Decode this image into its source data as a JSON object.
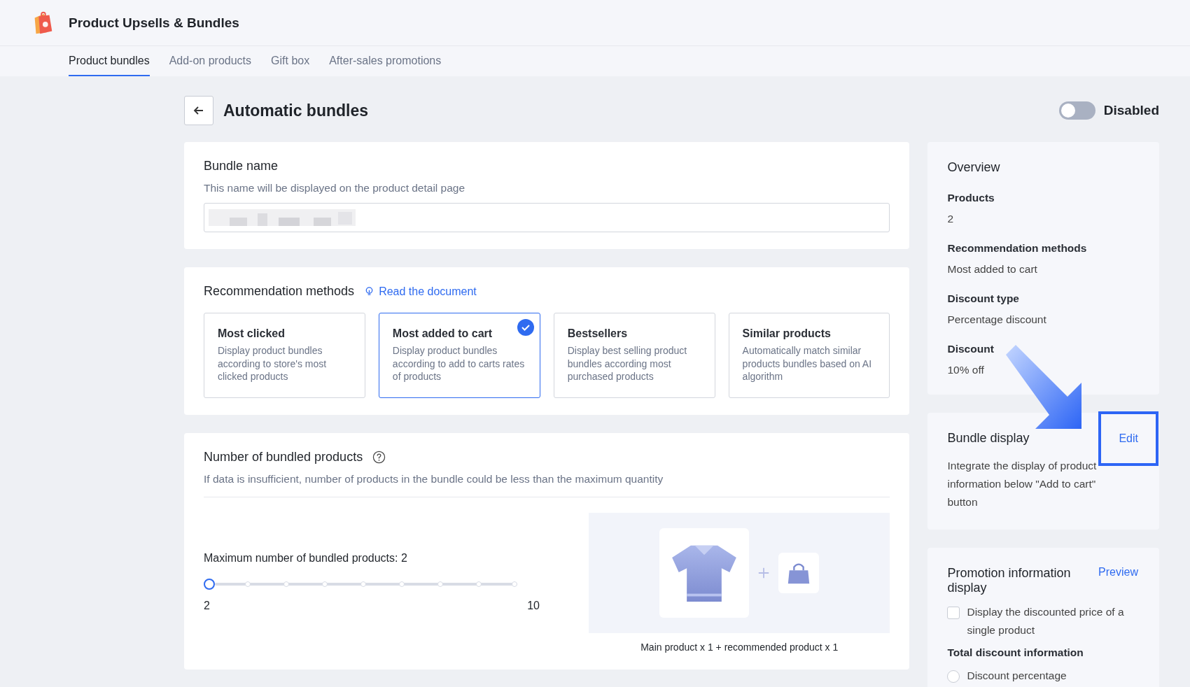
{
  "app": {
    "title": "Product Upsells & Bundles"
  },
  "tabs": [
    {
      "label": "Product bundles",
      "selected": true
    },
    {
      "label": "Add-on products",
      "selected": false
    },
    {
      "label": "Gift box",
      "selected": false
    },
    {
      "label": "After-sales promotions",
      "selected": false
    }
  ],
  "page": {
    "title": "Automatic bundles",
    "toggle": {
      "on": false,
      "label": "Disabled"
    }
  },
  "bundle_name": {
    "title": "Bundle name",
    "hint": "This name will be displayed on the product detail page",
    "value_redacted": true
  },
  "recommendation": {
    "title": "Recommendation methods",
    "link": "Read the document",
    "methods": [
      {
        "title": "Most clicked",
        "description": "Display product bundles according to store's most clicked products",
        "selected": false
      },
      {
        "title": "Most added to cart",
        "description": "Display product bundles according to add to carts rates of products",
        "selected": true
      },
      {
        "title": "Bestsellers",
        "description": "Display best selling product bundles according most purchased products",
        "selected": false
      },
      {
        "title": "Similar products",
        "description": "Automatically match similar products bundles based on AI algorithm",
        "selected": false
      }
    ]
  },
  "bundled_count": {
    "title": "Number of bundled products",
    "hint": "If data is insufficient, number of products in the bundle could be less than the maximum quantity",
    "slider_label": "Maximum number of bundled products: 2",
    "level": 0,
    "min_label": "2",
    "max_label": "10",
    "preview_caption": "Main product x 1 + recommended product x 1"
  },
  "overview": {
    "title": "Overview",
    "items": [
      {
        "label": "Products",
        "value": "2"
      },
      {
        "label": "Recommendation methods",
        "value": "Most added to cart"
      },
      {
        "label": "Discount type",
        "value": "Percentage discount"
      },
      {
        "label": "Discount",
        "value": "10% off"
      }
    ]
  },
  "bundle_display": {
    "title": "Bundle display",
    "action": "Edit",
    "description": "Integrate the display of product information below \"Add to cart\" button"
  },
  "promotion": {
    "title": "Promotion information display",
    "action": "Preview",
    "checkbox": {
      "label": "Display the discounted price of a single product",
      "checked": false
    },
    "subtitle": "Total discount information",
    "radio": {
      "label": "Discount percentage",
      "selected": false
    }
  }
}
